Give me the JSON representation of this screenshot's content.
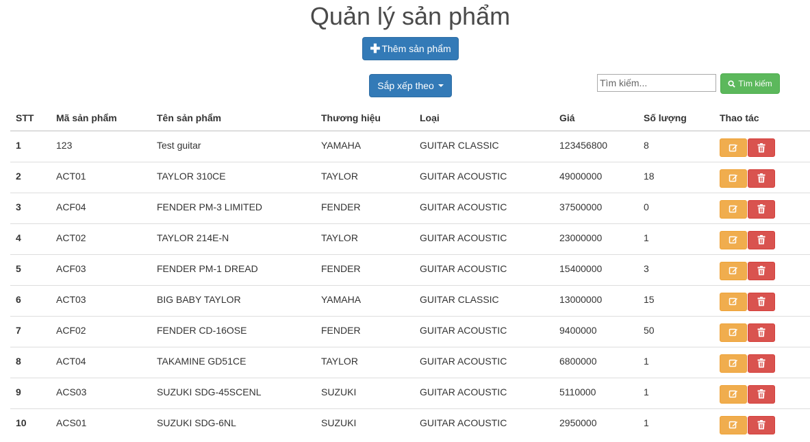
{
  "page": {
    "title": "Quản lý sản phẩm"
  },
  "toolbar": {
    "add_label": "Thêm sản phẩm",
    "add_icon": "plus-icon",
    "sort_label": "Sắp xếp theo",
    "search_placeholder": "Tìm kiếm...",
    "search_value": "",
    "search_label": "Tìm kiếm",
    "search_icon": "search-icon"
  },
  "colors": {
    "primary": "#337ab7",
    "success": "#5cb85c",
    "warning": "#f0ad4e",
    "danger": "#d9534f"
  },
  "table": {
    "headers": [
      "STT",
      "Mã sản phẩm",
      "Tên sản phẩm",
      "Thương hiệu",
      "Loại",
      "Giá",
      "Số lượng",
      "Thao tác"
    ],
    "rows": [
      {
        "stt": "1",
        "code": "123",
        "name": "Test guitar",
        "brand": "YAMAHA",
        "type": "GUITAR CLASSIC",
        "price": "123456800",
        "qty": "8"
      },
      {
        "stt": "2",
        "code": "ACT01",
        "name": "TAYLOR 310CE",
        "brand": "TAYLOR",
        "type": "GUITAR ACOUSTIC",
        "price": "49000000",
        "qty": "18"
      },
      {
        "stt": "3",
        "code": "ACF04",
        "name": "FENDER PM-3 LIMITED",
        "brand": "FENDER",
        "type": "GUITAR ACOUSTIC",
        "price": "37500000",
        "qty": "0"
      },
      {
        "stt": "4",
        "code": "ACT02",
        "name": "TAYLOR 214E-N",
        "brand": "TAYLOR",
        "type": "GUITAR ACOUSTIC",
        "price": "23000000",
        "qty": "1"
      },
      {
        "stt": "5",
        "code": "ACF03",
        "name": "FENDER PM-1 DREAD",
        "brand": "FENDER",
        "type": "GUITAR ACOUSTIC",
        "price": "15400000",
        "qty": "3"
      },
      {
        "stt": "6",
        "code": "ACT03",
        "name": "BIG BABY TAYLOR",
        "brand": "YAMAHA",
        "type": "GUITAR CLASSIC",
        "price": "13000000",
        "qty": "15"
      },
      {
        "stt": "7",
        "code": "ACF02",
        "name": "FENDER CD-16OSE",
        "brand": "FENDER",
        "type": "GUITAR ACOUSTIC",
        "price": "9400000",
        "qty": "50"
      },
      {
        "stt": "8",
        "code": "ACT04",
        "name": "TAKAMINE GD51CE",
        "brand": "TAYLOR",
        "type": "GUITAR ACOUSTIC",
        "price": "6800000",
        "qty": "1"
      },
      {
        "stt": "9",
        "code": "ACS03",
        "name": "SUZUKI SDG-45SCENL",
        "brand": "SUZUKI",
        "type": "GUITAR ACOUSTIC",
        "price": "5110000",
        "qty": "1"
      },
      {
        "stt": "10",
        "code": "ACS01",
        "name": "SUZUKI SDG-6NL",
        "brand": "SUZUKI",
        "type": "GUITAR ACOUSTIC",
        "price": "2950000",
        "qty": "1"
      }
    ],
    "row_actions": {
      "edit_icon": "edit-icon",
      "delete_icon": "trash-icon"
    }
  }
}
